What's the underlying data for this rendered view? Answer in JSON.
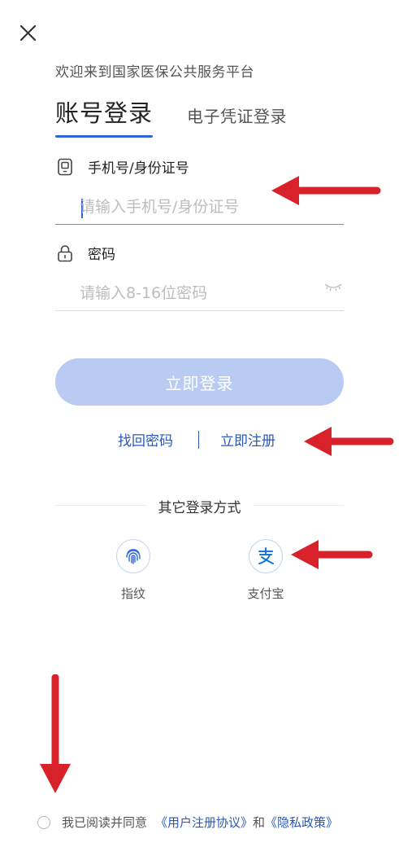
{
  "welcome": "欢迎来到国家医保公共服务平台",
  "tabs": {
    "active": "账号登录",
    "inactive": "电子凭证登录"
  },
  "account": {
    "label": "手机号/身份证号",
    "placeholder": "请输入手机号/身份证号"
  },
  "password": {
    "label": "密码",
    "placeholder": "请输入8-16位密码"
  },
  "login_button": "立即登录",
  "links": {
    "forgot": "找回密码",
    "register": "立即注册"
  },
  "other_login": {
    "title": "其它登录方式",
    "options": [
      {
        "label": "指纹",
        "icon": "fingerprint-icon"
      },
      {
        "label": "支付宝",
        "icon": "alipay-icon"
      }
    ]
  },
  "agreement": {
    "prefix": "我已阅读并同意",
    "user_agreement": "《用户注册协议》",
    "and": "和",
    "privacy": "《隐私政策》"
  },
  "colors": {
    "accent": "#2f66d6",
    "link": "#2a58b8",
    "button_disabled": "#b9cbf3",
    "annotation_arrow": "#d9212c"
  }
}
